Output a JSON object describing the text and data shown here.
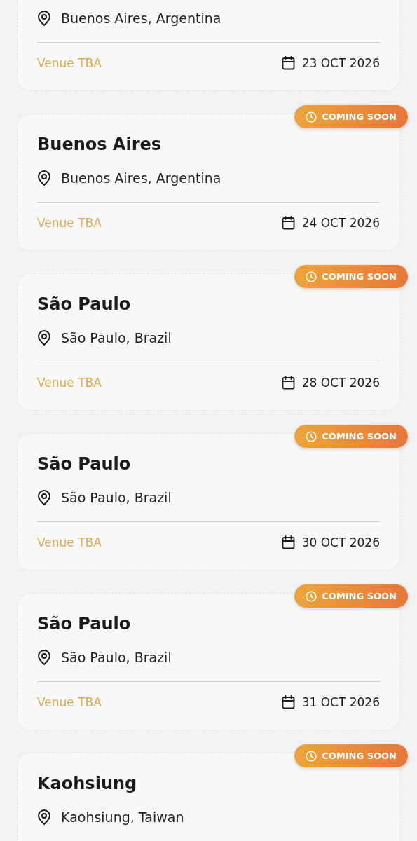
{
  "events": [
    {
      "location": "Buenos Aires, Argentina",
      "venue": "Venue TBA",
      "date": "23 OCT 2026"
    },
    {
      "badge": "COMING SOON",
      "title": "Buenos Aires",
      "location": "Buenos Aires, Argentina",
      "venue": "Venue TBA",
      "date": "24 OCT 2026"
    },
    {
      "badge": "COMING SOON",
      "title": "São Paulo",
      "location": "São Paulo, Brazil",
      "venue": "Venue TBA",
      "date": "28 OCT 2026"
    },
    {
      "badge": "COMING SOON",
      "title": "São Paulo",
      "location": "São Paulo, Brazil",
      "venue": "Venue TBA",
      "date": "30 OCT 2026"
    },
    {
      "badge": "COMING SOON",
      "title": "São Paulo",
      "location": "São Paulo, Brazil",
      "venue": "Venue TBA",
      "date": "31 OCT 2026"
    },
    {
      "badge": "COMING SOON",
      "title": "Kaohsiung",
      "location": "Kaohsiung, Taiwan"
    }
  ]
}
